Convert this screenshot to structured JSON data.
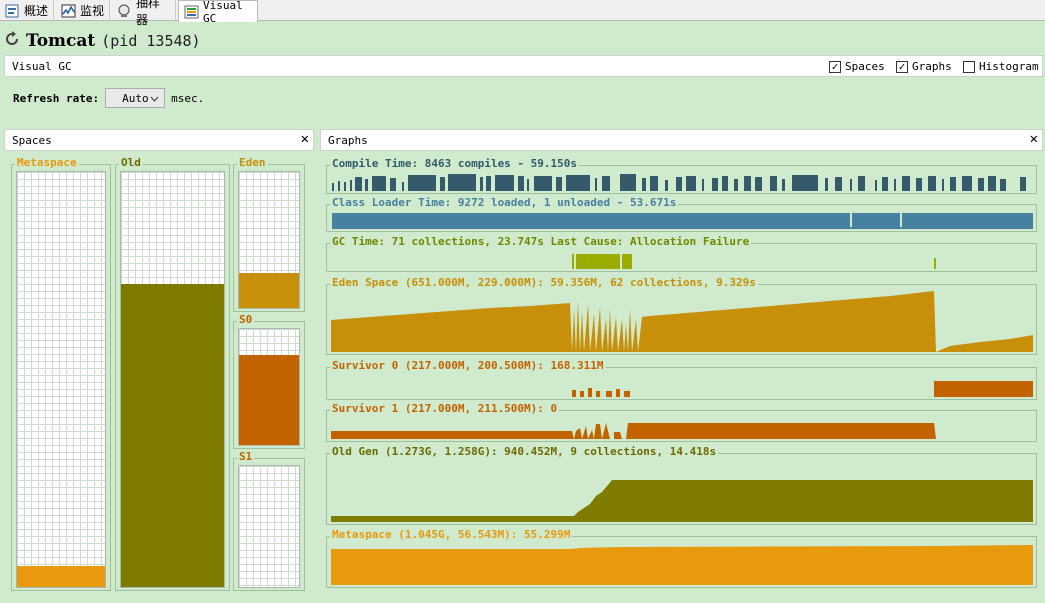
{
  "tabs": [
    {
      "label": "概述",
      "icon": "overview-icon"
    },
    {
      "label": "监视",
      "icon": "monitor-icon"
    },
    {
      "label": "抽样器",
      "icon": "sampler-icon"
    },
    {
      "label": "Visual GC",
      "icon": "visual-gc-icon"
    }
  ],
  "app": {
    "title": "Tomcat",
    "pid": "(pid 13548)"
  },
  "header": {
    "label": "Visual GC",
    "spaces_label": "Spaces",
    "graphs_label": "Graphs",
    "histogram_label": "Histogram",
    "spaces_checked": true,
    "graphs_checked": true,
    "histogram_checked": false
  },
  "refresh": {
    "label": "Refresh rate:",
    "value": "Auto",
    "unit": "msec."
  },
  "spaces_panel": {
    "title": "Spaces",
    "metaspace": {
      "label": "Metaspace",
      "color": "#e89a0f",
      "fill": 0.05
    },
    "old": {
      "label": "Old",
      "color": "#7f7a00",
      "fill": 0.73
    },
    "eden": {
      "label": "Eden",
      "color": "#c8900a",
      "fill": 0.26
    },
    "s0": {
      "label": "S0",
      "color": "#c36300",
      "fill": 0.78
    },
    "s1": {
      "label": "S1",
      "color": "#c36300",
      "fill": 0.0
    }
  },
  "graphs_panel": {
    "title": "Graphs",
    "compile": {
      "label": "Compile Time: 8463 compiles - 59.150s",
      "color": "#345a6b"
    },
    "classloader": {
      "label": "Class Loader Time: 9272 loaded, 1 unloaded - 53.671s",
      "color": "#4880a0"
    },
    "gc": {
      "label": "GC Time: 71 collections, 23.747s  Last Cause: Allocation Failure",
      "color": "#9aac00"
    },
    "eden": {
      "label": "Eden Space (651.000M, 229.000M): 59.356M, 62 collections, 9.329s",
      "color": "#c8900a"
    },
    "survivor0": {
      "label": "Survivor 0 (217.000M, 200.500M): 168.311M",
      "color": "#c36300"
    },
    "survivor1": {
      "label": "Survivor 1 (217.000M, 211.500M): 0",
      "color": "#c36300"
    },
    "oldgen": {
      "label": "Old Gen (1.273G, 1.258G): 940.452M, 9 collections, 14.418s",
      "color": "#7f7a00"
    },
    "metaspace": {
      "label": "Metaspace (1.045G, 56.543M): 55.299M",
      "color": "#e89a0f"
    }
  }
}
